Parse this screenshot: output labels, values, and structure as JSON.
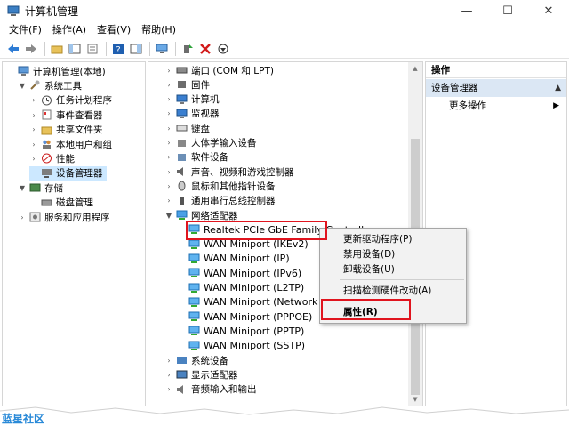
{
  "window": {
    "title": "计算机管理",
    "minimize": "—",
    "maximize": "☐",
    "close": "✕"
  },
  "menu": [
    "文件(F)",
    "操作(A)",
    "查看(V)",
    "帮助(H)"
  ],
  "left_tree": [
    {
      "label": "计算机管理(本地)",
      "level": 0,
      "expander": "",
      "icon": "computer-management-icon"
    },
    {
      "label": "系统工具",
      "level": 1,
      "expander": "▼",
      "icon": "system-tools-icon"
    },
    {
      "label": "任务计划程序",
      "level": 2,
      "expander": "›",
      "icon": "clock-icon"
    },
    {
      "label": "事件查看器",
      "level": 2,
      "expander": "›",
      "icon": "event-viewer-icon"
    },
    {
      "label": "共享文件夹",
      "level": 2,
      "expander": "›",
      "icon": "shared-folder-icon"
    },
    {
      "label": "本地用户和组",
      "level": 2,
      "expander": "›",
      "icon": "users-icon"
    },
    {
      "label": "性能",
      "level": 2,
      "expander": "›",
      "icon": "performance-icon"
    },
    {
      "label": "设备管理器",
      "level": 2,
      "expander": "",
      "icon": "device-manager-icon",
      "selected": true
    },
    {
      "label": "存储",
      "level": 1,
      "expander": "▼",
      "icon": "storage-icon"
    },
    {
      "label": "磁盘管理",
      "level": 2,
      "expander": "",
      "icon": "disk-icon"
    },
    {
      "label": "服务和应用程序",
      "level": 1,
      "expander": "›",
      "icon": "services-icon"
    }
  ],
  "device_tree": [
    {
      "label": "端口 (COM 和 LPT)",
      "level": 0,
      "expander": "›",
      "icon": "port-icon"
    },
    {
      "label": "固件",
      "level": 0,
      "expander": "›",
      "icon": "firmware-icon"
    },
    {
      "label": "计算机",
      "level": 0,
      "expander": "›",
      "icon": "monitor-icon"
    },
    {
      "label": "监视器",
      "level": 0,
      "expander": "›",
      "icon": "monitor-icon"
    },
    {
      "label": "键盘",
      "level": 0,
      "expander": "›",
      "icon": "keyboard-icon"
    },
    {
      "label": "人体学输入设备",
      "level": 0,
      "expander": "›",
      "icon": "hid-icon"
    },
    {
      "label": "软件设备",
      "level": 0,
      "expander": "›",
      "icon": "software-device-icon"
    },
    {
      "label": "声音、视频和游戏控制器",
      "level": 0,
      "expander": "›",
      "icon": "sound-icon"
    },
    {
      "label": "鼠标和其他指针设备",
      "level": 0,
      "expander": "›",
      "icon": "mouse-icon"
    },
    {
      "label": "通用串行总线控制器",
      "level": 0,
      "expander": "›",
      "icon": "usb-icon"
    },
    {
      "label": "网络适配器",
      "level": 0,
      "expander": "▼",
      "icon": "network-icon"
    },
    {
      "label": "Realtek PCIe GbE Family Controller",
      "level": 1,
      "expander": "",
      "icon": "network-adapter-icon",
      "highlighted": true
    },
    {
      "label": "WAN Miniport (IKEv2)",
      "level": 1,
      "expander": "",
      "icon": "network-adapter-icon"
    },
    {
      "label": "WAN Miniport (IP)",
      "level": 1,
      "expander": "",
      "icon": "network-adapter-icon"
    },
    {
      "label": "WAN Miniport (IPv6)",
      "level": 1,
      "expander": "",
      "icon": "network-adapter-icon"
    },
    {
      "label": "WAN Miniport (L2TP)",
      "level": 1,
      "expander": "",
      "icon": "network-adapter-icon"
    },
    {
      "label": "WAN Miniport (Network Monitor)",
      "level": 1,
      "expander": "",
      "icon": "network-adapter-icon"
    },
    {
      "label": "WAN Miniport (PPPOE)",
      "level": 1,
      "expander": "",
      "icon": "network-adapter-icon"
    },
    {
      "label": "WAN Miniport (PPTP)",
      "level": 1,
      "expander": "",
      "icon": "network-adapter-icon"
    },
    {
      "label": "WAN Miniport (SSTP)",
      "level": 1,
      "expander": "",
      "icon": "network-adapter-icon"
    },
    {
      "label": "系统设备",
      "level": 0,
      "expander": "›",
      "icon": "system-device-icon"
    },
    {
      "label": "显示适配器",
      "level": 0,
      "expander": "›",
      "icon": "display-adapter-icon"
    },
    {
      "label": "音频输入和输出",
      "level": 0,
      "expander": "›",
      "icon": "audio-icon"
    }
  ],
  "actions": {
    "header": "操作",
    "section": "设备管理器",
    "more": "更多操作"
  },
  "context_menu": [
    {
      "label": "更新驱动程序(P)",
      "bold": false
    },
    {
      "label": "禁用设备(D)",
      "bold": false
    },
    {
      "label": "卸载设备(U)",
      "bold": false
    },
    {
      "label": "扫描检测硬件改动(A)",
      "bold": false
    },
    {
      "label": "属性(R)",
      "bold": true
    }
  ],
  "watermark": "蓝星社区",
  "colors": {
    "highlight_red": "#e0141e",
    "selection": "#cce8ff",
    "action_section": "#dbe7f4"
  }
}
